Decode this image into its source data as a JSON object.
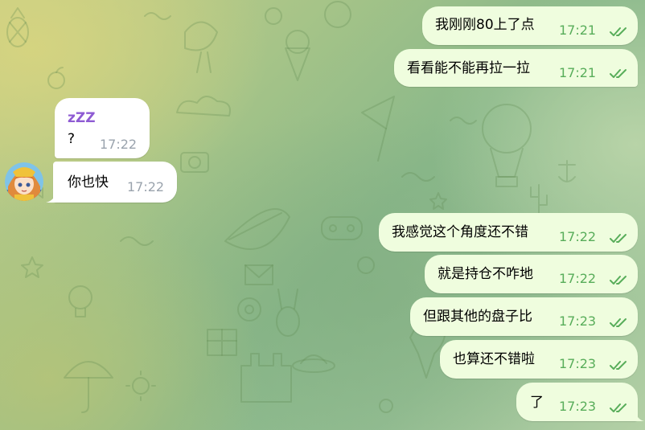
{
  "theme": {
    "outgoing_bubble": "#effdde",
    "incoming_bubble": "#ffffff",
    "outgoing_time_color": "#58ad5a",
    "incoming_time_color": "#9aa3ad",
    "sender_color": "#8e5bd3"
  },
  "messages": [
    {
      "direction": "out",
      "text": "我刚刚80上了点",
      "time": "17:21",
      "status": "read-double-check-icon"
    },
    {
      "direction": "out",
      "text": "看看能不能再拉一拉",
      "time": "17:21",
      "status": "read-double-check-icon"
    },
    {
      "direction": "in",
      "sender": "zZZ",
      "text": "?",
      "time": "17:22"
    },
    {
      "direction": "in",
      "text": "你也快",
      "time": "17:22",
      "avatar": "anime-girl-avatar"
    },
    {
      "direction": "out",
      "text": "我感觉这个角度还不错",
      "time": "17:22",
      "status": "read-double-check-icon"
    },
    {
      "direction": "out",
      "text": "就是持仓不咋地",
      "time": "17:22",
      "status": "read-double-check-icon"
    },
    {
      "direction": "out",
      "text": "但跟其他的盘子比",
      "time": "17:23",
      "status": "read-double-check-icon"
    },
    {
      "direction": "out",
      "text": "也算还不错啦",
      "time": "17:23",
      "status": "read-double-check-icon"
    },
    {
      "direction": "out",
      "text": "了",
      "time": "17:23",
      "status": "read-double-check-icon"
    }
  ]
}
